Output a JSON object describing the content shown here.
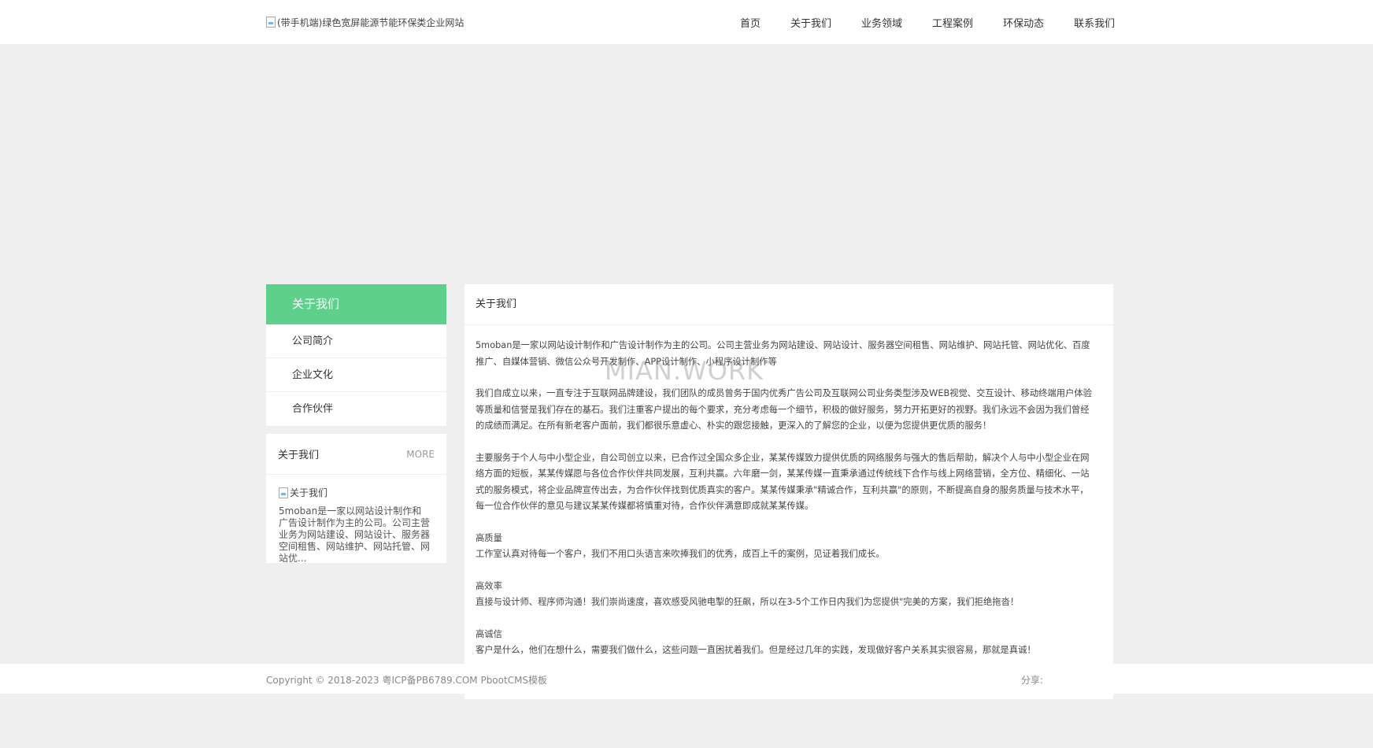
{
  "header": {
    "logo_alt": "(带手机端)绿色宽屏能源节能环保类企业网站",
    "nav": [
      "首页",
      "关于我们",
      "业务领域",
      "工程案例",
      "环保动态",
      "联系我们"
    ]
  },
  "sidebar": {
    "title": "关于我们",
    "items": [
      "公司简介",
      "企业文化",
      "合作伙伴"
    ]
  },
  "about_box": {
    "title": "关于我们",
    "more": "MORE",
    "img_alt": "关于我们",
    "text": "5moban是一家以网站设计制作和广告设计制作为主的公司。公司主营业务为网站建设、网站设计、服务器空间租售、网站维护、网站托管、网站优..."
  },
  "content": {
    "title": "关于我们",
    "paragraphs": [
      "5moban是一家以网站设计制作和广告设计制作为主的公司。公司主营业务为网站建设、网站设计、服务器空间租售、网站维护、网站托管、网站优化、百度推广、自媒体营销、微信公众号开发制作、APP设计制作、小程序设计制作等",
      "我们自成立以来，一直专注于互联网品牌建设，我们团队的成员曾务于国内优秀广告公司及互联网公司业务类型涉及WEB视觉、交互设计、移动终端用户体验等质量和信誉是我们存在的基石。我们注重客户提出的每个要求，充分考虑每一个细节，积极的做好服务，努力开拓更好的视野。我们永远不会因为我们曾经的成绩而满足。在所有新老客户面前，我们都很乐意虚心、朴实的跟您接触，更深入的了解您的企业，以便为您提供更优质的服务！",
      "主要服务于个人与中小型企业，自公司创立以来，已合作过全国众多企业，某某传媒致力提供优质的网络服务与强大的售后帮助，解决个人与中小型企业在网络方面的短板，某某传媒愿与各位合作伙伴共同发展，互利共赢。六年磨一剑，某某传媒一直秉承通过传统线下合作与线上网络营销，全方位、精细化、一站式的服务模式，将企业品牌宣传出去，为合作伙伴找到优质真实的客户。某某传媒秉承\"精诚合作，互利共赢\"的原则，不断提高自身的服务质量与技术水平，每一位合作伙伴的意见与建议某某传媒都将慎重对待，合作伙伴满意即成就某某传媒。"
    ],
    "features": [
      {
        "head": "高质量",
        "text": "工作室认真对待每一个客户，我们不用口头语言来吹捧我们的优秀，成百上千的案例，见证着我们成长。"
      },
      {
        "head": "高效率",
        "text": "直接与设计师、程序师沟通！我们崇尚速度，喜欢感受风驰电掣的狂飙，所以在3-5个工作日内我们为您提供\"完美的方案，我们拒绝拖沓！"
      },
      {
        "head": "高诚信",
        "text": "客户是什么，他们在想什么，需要我们做什么，这些问题一直困扰着我们。但是经过几年的实践，发现做好客户关系其实很容易，那就是真诚！"
      }
    ]
  },
  "watermark": "MIAN.WORK",
  "footer": {
    "copyright": "Copyright © 2018-2023  粤ICP备PB6789.COM PbootCMS模板",
    "share": "分享:"
  }
}
